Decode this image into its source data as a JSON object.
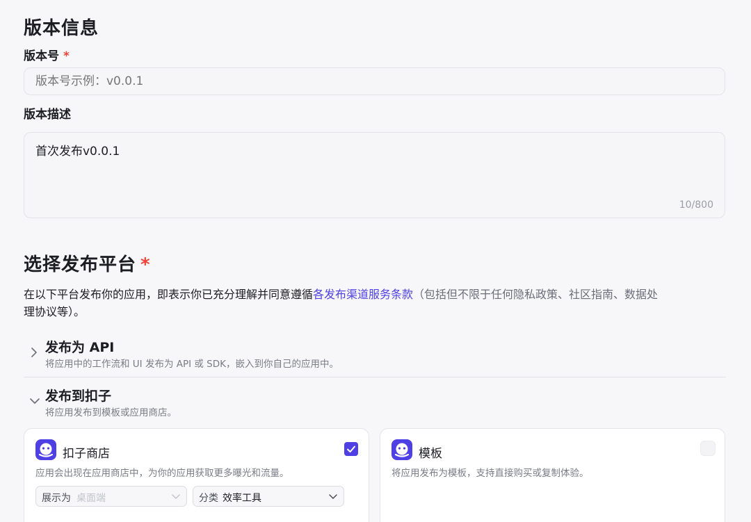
{
  "version": {
    "section_title": "版本信息",
    "number_label": "版本号",
    "required_mark": "*",
    "number_placeholder": "版本号示例：v0.0.1",
    "number_value": "",
    "desc_label": "版本描述",
    "desc_value": "首次发布v0.0.1",
    "desc_counter": "10/800"
  },
  "platform": {
    "section_title": "选择发布平台",
    "required_mark": "*",
    "desc_prefix": "在以下平台发布你的应用，即表示你已充分理解并同意遵循",
    "desc_link": "各发布渠道服务条款",
    "desc_suffix_line1": "（包括但不限于任何隐私政策、社区指南、数据处",
    "desc_suffix_line2": "理协议等）。",
    "api": {
      "title": "发布为 API",
      "subtitle": "将应用中的工作流和 UI 发布为 API 或 SDK，嵌入到你自己的应用中。",
      "expanded": false
    },
    "coze": {
      "title": "发布到扣子",
      "subtitle": "将应用发布到模板或应用商店。",
      "expanded": true,
      "cards": [
        {
          "title": "扣子商店",
          "description": "应用会出现在应用商店中，为你的应用获取更多曝光和流量。",
          "checked": true,
          "display_select": {
            "label": "展示为",
            "value": "桌面端"
          },
          "category_select": {
            "label": "分类",
            "value": "效率工具"
          }
        },
        {
          "title": "模板",
          "description": "将应用发布为模板，支持直接购买或复制体验。",
          "checked": false
        }
      ]
    }
  },
  "colors": {
    "accent": "#4e40e5",
    "required": "#f04438",
    "background": "#f7f7f9"
  },
  "icons": {
    "chevron_collapsed": "chevron-right-icon",
    "chevron_expanded": "chevron-down-icon",
    "app_logo": "coze-logo-icon",
    "check": "checkmark-icon"
  }
}
